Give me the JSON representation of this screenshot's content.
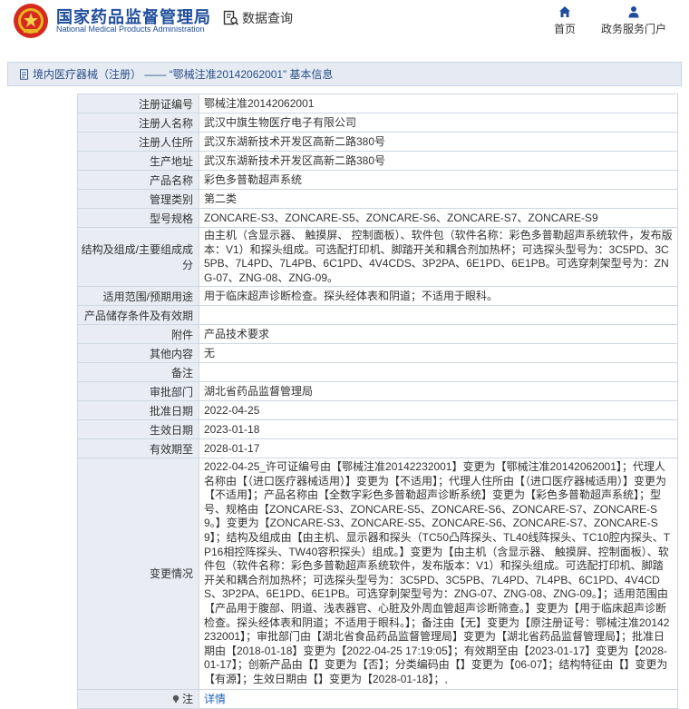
{
  "header": {
    "brand_cn": "国家药品监督管理局",
    "brand_en": "National Medical Products Administration",
    "data_query": "数据查询",
    "nav_home": "首页",
    "nav_services": "政务服务门户"
  },
  "breadcrumb": {
    "text": "境内医疗器械（注册） —— “鄂械注准20142062001” 基本信息"
  },
  "rows": [
    {
      "label": "注册证编号",
      "value": "鄂械注准20142062001"
    },
    {
      "label": "注册人名称",
      "value": "武汉中旗生物医疗电子有限公司"
    },
    {
      "label": "注册人住所",
      "value": "武汉东湖新技术开发区高新二路380号"
    },
    {
      "label": "生产地址",
      "value": "武汉东湖新技术开发区高新二路380号"
    },
    {
      "label": "产品名称",
      "value": "彩色多普勒超声系统"
    },
    {
      "label": "管理类别",
      "value": "第二类"
    },
    {
      "label": "型号规格",
      "value": "ZONCARE-S3、ZONCARE-S5、ZONCARE-S6、ZONCARE-S7、ZONCARE-S9"
    },
    {
      "label": "结构及组成/主要组成成分",
      "value": "由主机（含显示器、 触摸屏、 控制面板）、软件包（软件名称：彩色多普勒超声系统软件，发布版本：V1）和探头组成。可选配打印机、脚踏开关和耦合剂加热杯；可选探头型号为：3C5PD、3C5PB、7L4PD、7L4PB、6C1PD、4V4CDS、3P2PA、6E1PD、6E1PB。可选穿刺架型号为：ZNG-07、ZNG-08、ZNG-09。"
    },
    {
      "label": "适用范围/预期用途",
      "value": "用于临床超声诊断检查。探头经体表和阴道；不适用于眼科。"
    },
    {
      "label": "产品储存条件及有效期",
      "value": ""
    },
    {
      "label": "附件",
      "value": "产品技术要求"
    },
    {
      "label": "其他内容",
      "value": "无"
    },
    {
      "label": "备注",
      "value": ""
    },
    {
      "label": "审批部门",
      "value": "湖北省药品监督管理局"
    },
    {
      "label": "批准日期",
      "value": "2022-04-25"
    },
    {
      "label": "生效日期",
      "value": "2023-01-18"
    },
    {
      "label": "有效期至",
      "value": "2028-01-17"
    },
    {
      "label": "变更情况",
      "value": "2022-04-25_许可证编号由【鄂械注准20142232001】变更为【鄂械注准20142062001】；代理人名称由【（进口医疗器械适用）】变更为【不适用】；代理人住所由【（进口医疗器械适用）】变更为【不适用】；产品名称由【全数字彩色多普勒超声诊断系统】变更为【彩色多普勒超声系统】；型号、规格由【ZONCARE-S3、ZONCARE-S5、ZONCARE-S6、ZONCARE-S7、ZONCARE-S9。】变更为【ZONCARE-S3、ZONCARE-S5、ZONCARE-S6、ZONCARE-S7、ZONCARE-S9】；结构及组成由【由主机、显示器和探头（TC50凸阵探头、TL40线阵探头、TC10腔内探头、TP16相控阵探头、TW40容积探头）组成。】变更为【由主机（含显示器、 触摸屏、控制面板）、软件包（软件名称：彩色多普勒超声系统软件，发布版本：V1）和探头组成。可选配打印机、脚踏开关和耦合剂加热杯；可选探头型号为：3C5PD、3C5PB、7L4PD、7L4PB、6C1PD、4V4CDS、3P2PA、6E1PD、6E1PB。可选穿刺架型号为：ZNG-07、ZNG-08、ZNG-09。】；适用范围由【产品用于腹部、阴道、浅表器官、心脏及外周血管超声诊断筛查。】变更为【用于临床超声诊断检查。探头经体表和阴道；不适用于眼科。】；备注由【无】变更为【原注册证号：鄂械注准20142232001】；审批部门由【湖北省食品药品监督管理局】变更为【湖北省药品监督管理局】；批准日期由【2018-01-18】变更为【2022-04-25 17:19:05】；有效期至由【2023-01-17】变更为【2028-01-17】；创新产品由【】变更为【否】；分类编码由【】变更为【06-07】；结构特征由【】变更为【有源】；生效日期由【】变更为【2028-01-18】；,"
    },
    {
      "label": "注",
      "value": "详情"
    }
  ],
  "colors": {
    "brand_blue": "#1f4e9c",
    "label_bg": "#e9edf3",
    "crumb_bg": "#e6ebf3",
    "link": "#1f62b5"
  },
  "icons": {
    "logo": "national-emblem-icon",
    "data_query": "search-document-icon",
    "home": "home-icon",
    "services": "user-icon",
    "breadcrumb": "document-icon",
    "note": "pin-icon"
  }
}
